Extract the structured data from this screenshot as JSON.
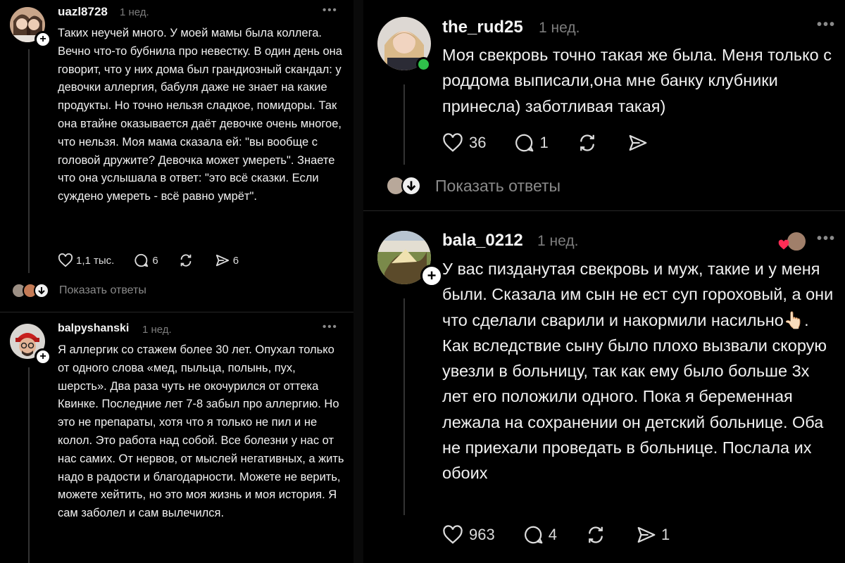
{
  "left": {
    "top_comment": {
      "username": "uazl8728",
      "time": "1 нед.",
      "text": "Таких неучей много. У моей мамы была коллега. Вечно что-то бубнила про невестку. В один день она говорит, что у них дома был грандиозный скандал: у девочки аллергия, бабуля даже не знает на какие продукты. Но точно нельзя сладкое, помидоры. Так она втайне оказывается даёт девочке очень многое, что нельзя. Моя мама сказала ей: \"вы вообще с головой дружите? Девочка может умереть\". Знаете что она услышала в ответ: \"это всё сказки. Если суждено умереть - всё равно умрёт\".",
      "likes": "1,1 тыс.",
      "replies": "6",
      "shares": "6"
    },
    "show_replies": "Показать ответы",
    "second_comment": {
      "username": "balpyshanski",
      "time": "1 нед.",
      "text": "Я аллергик со стажем более 30 лет. Опухал только от одного слова «мед, пыльца, полынь, пух, шерсть». Два раза чуть не окочурился от оттека Квинке. Последние лет 7-8 забыл про аллергию. Но это не препараты, хотя что я только не пил и не колол. Это работа над собой. Все болезни у нас от нас самих. От нервов, от мыслей негативных, а жить надо в радости и благодарности. Можете не верить, можете хейтить, но это моя жизнь и моя история. Я сам заболел и сам вылечился."
    }
  },
  "right": {
    "first_comment": {
      "username": "the_rud25",
      "time": "1 нед.",
      "text": "Моя свекровь точно такая же была. Меня только с роддома выписали,она мне банку клубники принесла) заботливая такая)",
      "likes": "36",
      "replies": "1"
    },
    "show_replies": "Показать ответы",
    "second_comment": {
      "username": "bala_0212",
      "time": "1 нед.",
      "text": "У вас пизданутая свекровь и  муж, такие и у меня были. Сказала им сын не ест суп гороховый, а они что сделали сварили и накормили насильно👆🏻. Как вследствие сыну было плохо вызвали скорую увезли в больницу, так как ему было больше 3х лет его положили одного. Пока я беременная лежала на сохранении он детский больнице. Оба не приехали проведать в больнице. Послала их обоих",
      "likes": "963",
      "replies": "4",
      "shares": "1"
    }
  },
  "more_glyph": "•••",
  "plus_glyph": "+"
}
